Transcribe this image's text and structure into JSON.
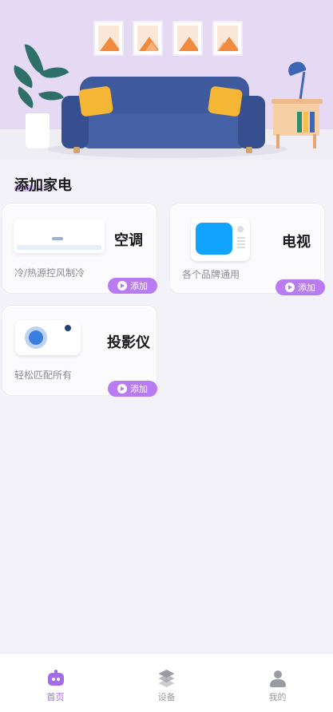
{
  "section": {
    "title": "添加家电"
  },
  "devices": [
    {
      "name": "空调",
      "desc": "冷/热源控风制冷",
      "button": "添加"
    },
    {
      "name": "电视",
      "desc": "各个品牌通用",
      "button": "添加"
    },
    {
      "name": "投影仪",
      "desc": "轻松匹配所有",
      "button": "添加"
    }
  ],
  "nav": [
    {
      "label": "首页",
      "icon": "robot-icon",
      "active": true
    },
    {
      "label": "设备",
      "icon": "layers-icon",
      "active": false
    },
    {
      "label": "我的",
      "icon": "user-icon",
      "active": false
    }
  ],
  "colors": {
    "accent": "#b87cf0",
    "nav_active": "#a36be6",
    "hero_bg": "#e6d9f3",
    "page_bg": "#f3f2f8"
  }
}
